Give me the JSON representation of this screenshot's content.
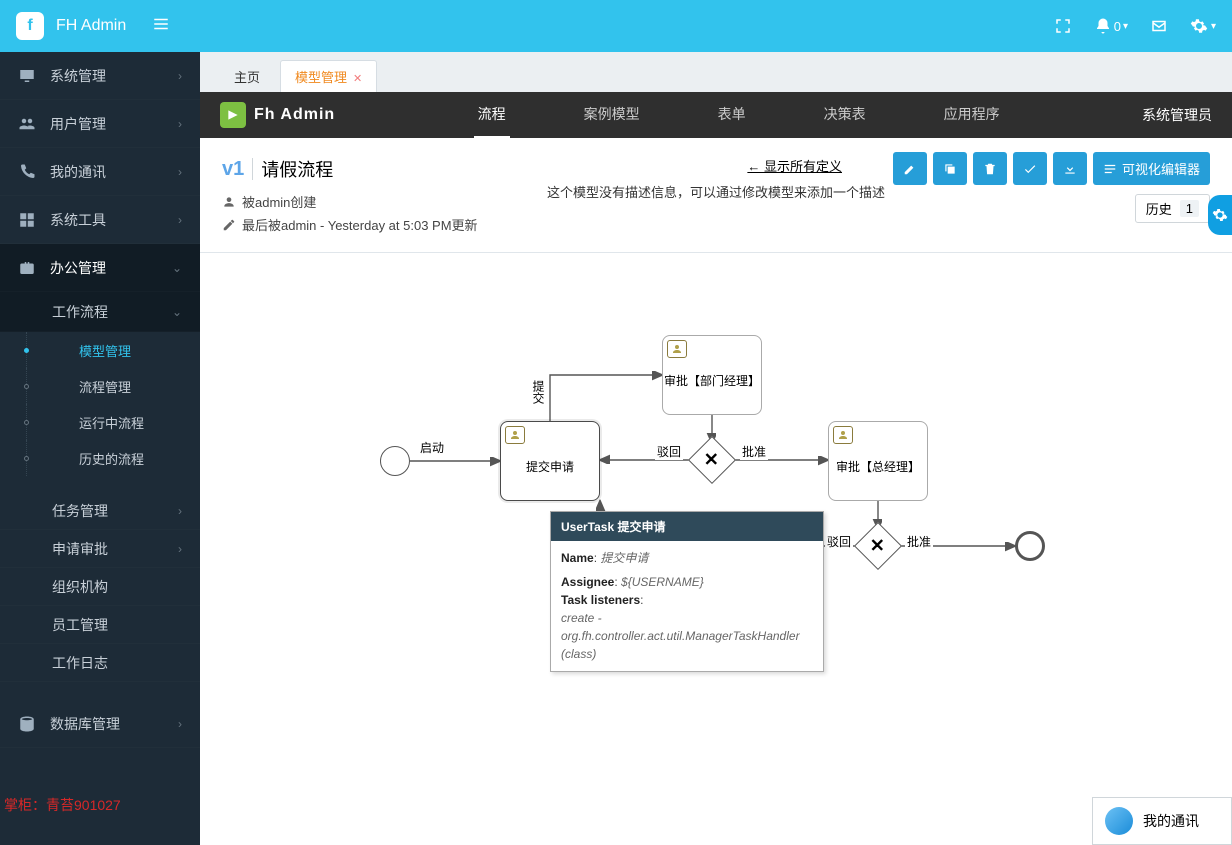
{
  "top": {
    "brand": "FH Admin",
    "notif_count": "0"
  },
  "sidebar": {
    "items": [
      {
        "label": "系统管理",
        "chev": "›"
      },
      {
        "label": "用户管理",
        "chev": "›"
      },
      {
        "label": "我的通讯",
        "chev": "›"
      },
      {
        "label": "系统工具",
        "chev": "›"
      },
      {
        "label": "办公管理",
        "chev": "⌄",
        "active": true
      },
      {
        "label": "数据库管理",
        "chev": "›"
      }
    ],
    "workflow_header": "工作流程",
    "workflow_children": [
      {
        "label": "模型管理",
        "sel": true
      },
      {
        "label": "流程管理"
      },
      {
        "label": "运行中流程"
      },
      {
        "label": "历史的流程"
      }
    ],
    "office_children": [
      {
        "label": "任务管理",
        "chev": "›"
      },
      {
        "label": "申请审批",
        "chev": "›"
      },
      {
        "label": "组织机构"
      },
      {
        "label": "员工管理"
      },
      {
        "label": "工作日志"
      }
    ],
    "footer": "掌柜：青苔901027"
  },
  "tabs": [
    {
      "label": "主页",
      "active": false
    },
    {
      "label": "模型管理",
      "active": true
    }
  ],
  "appbar": {
    "logo_text": "Fh Admin",
    "tabs": [
      {
        "label": "流程",
        "active": true
      },
      {
        "label": "案例模型"
      },
      {
        "label": "表单"
      },
      {
        "label": "决策表"
      },
      {
        "label": "应用程序"
      }
    ],
    "user": "系统管理员"
  },
  "detail": {
    "version": "v1",
    "title": "请假流程",
    "created_by": "被admin创建",
    "last_mod": "最后被admin - Yesterday at 5:03 PM更新",
    "description": "这个模型没有描述信息，可以通过修改模型来添加一个描述",
    "show_all": "← 显示所有定义",
    "visual_editor": "可视化编辑器",
    "history_label": "历史",
    "history_count": "1"
  },
  "diagram": {
    "start_label": "启动",
    "task1": "提交申请",
    "task2": "审批【部门经理】",
    "task3": "审批【总经理】",
    "edge_submit": "提交",
    "edge_reject1": "驳回",
    "edge_approve1": "批准",
    "edge_reject2": "驳回",
    "edge_approve2": "批准"
  },
  "tooltip": {
    "header": "UserTask 提交申请",
    "name_label": "Name",
    "name_value": "提交申请",
    "assignee_label": "Assignee",
    "assignee_value": "${USERNAME}",
    "listeners_label": "Task listeners",
    "listeners_value": "create - org.fh.controller.act.util.ManagerTaskHandler (class)"
  },
  "contact": {
    "label": "我的通讯"
  }
}
